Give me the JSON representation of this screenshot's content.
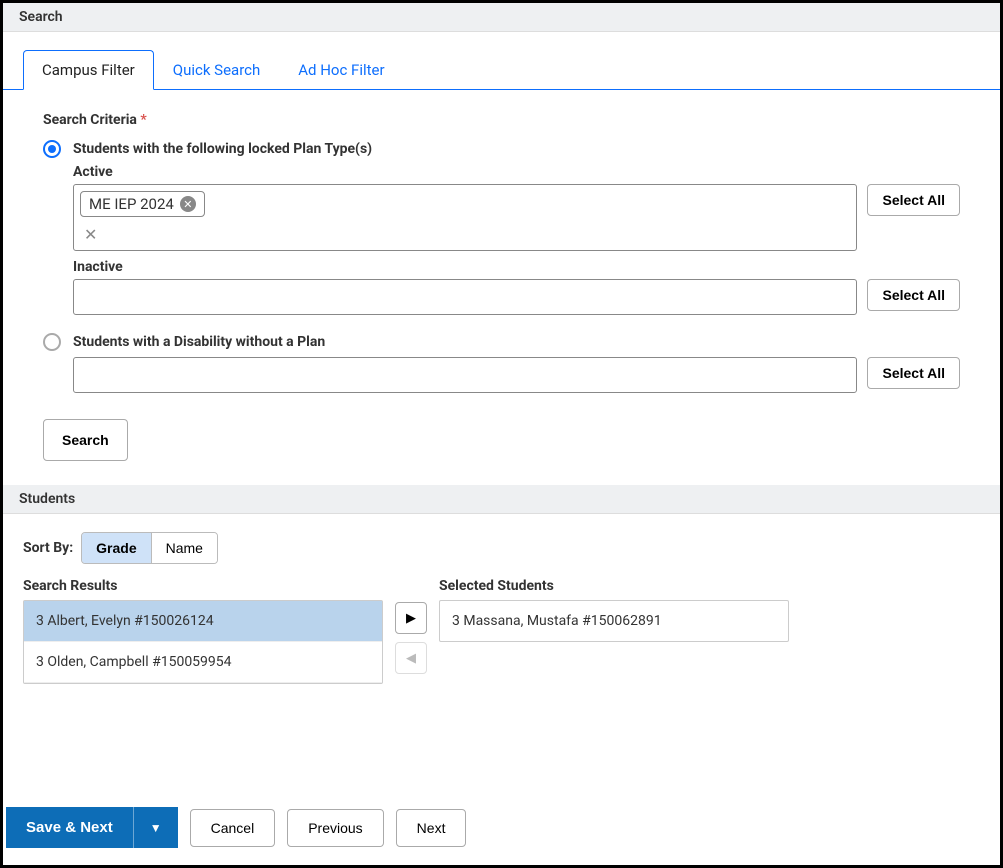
{
  "search_section_title": "Search",
  "tabs": {
    "campus_filter": "Campus Filter",
    "quick_search": "Quick Search",
    "ad_hoc_filter": "Ad Hoc Filter"
  },
  "criteria": {
    "label": "Search Criteria",
    "required_marker": "*",
    "option_locked": "Students with the following locked Plan Type(s)",
    "option_disability": "Students with a Disability without a Plan",
    "active_label": "Active",
    "inactive_label": "Inactive",
    "chip_text": "ME IEP 2024",
    "select_all": "Select All",
    "search_button": "Search"
  },
  "students_section_title": "Students",
  "sort": {
    "label": "Sort By:",
    "grade": "Grade",
    "name": "Name"
  },
  "results": {
    "title": "Search Results",
    "items": [
      "3 Albert, Evelyn #150026124",
      "3 Olden, Campbell #150059954"
    ]
  },
  "selected": {
    "title": "Selected Students",
    "items": [
      "3 Massana, Mustafa #150062891"
    ]
  },
  "footer": {
    "save_next": "Save & Next",
    "dropdown_glyph": "▼",
    "cancel": "Cancel",
    "previous": "Previous",
    "next": "Next"
  },
  "icons": {
    "move_right": "▶",
    "move_left": "◀"
  }
}
